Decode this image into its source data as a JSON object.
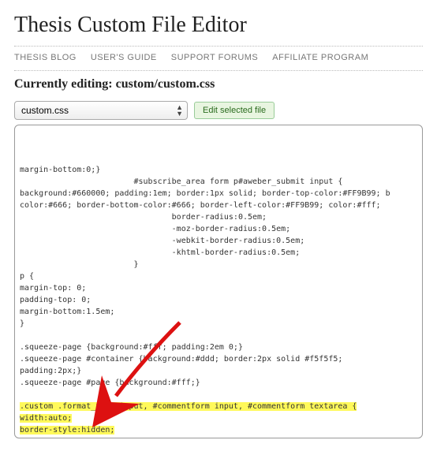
{
  "page": {
    "title": "Thesis Custom File Editor"
  },
  "nav": {
    "items": [
      "THESIS BLOG",
      "USER'S GUIDE",
      "SUPPORT FORUMS",
      "AFFILIATE PROGRAM"
    ]
  },
  "editing": {
    "label": "Currently editing:",
    "filename": "custom/custom.css"
  },
  "controls": {
    "file_select_value": "custom.css",
    "edit_button_label": "Edit selected file"
  },
  "code": {
    "lines": [
      "margin-bottom:0;}",
      "                        #subscribe_area form p#aweber_submit input {",
      "background:#660000; padding:1em; border:1px solid; border-top-color:#FF9B99; b",
      "color:#666; border-bottom-color:#666; border-left-color:#FF9B99; color:#fff;",
      "                                border-radius:0.5em;",
      "                                -moz-border-radius:0.5em;",
      "                                -webkit-border-radius:0.5em;",
      "                                -khtml-border-radius:0.5em;",
      "                        }",
      "p {",
      "margin-top: 0;",
      "padding-top: 0;",
      "margin-bottom:1.5em;",
      "}",
      "",
      ".squeeze-page {background:#fff; padding:2em 0;}",
      ".squeeze-page #container {background:#ddd; border:2px solid #f5f5f5;",
      "padding:2px;}",
      ".squeeze-page #page {background:#fff;}",
      ""
    ],
    "highlighted": [
      ".custom .format_text input, #commentform input, #commentform textarea {",
      "width:auto;",
      "border-style:hidden;",
      "}"
    ]
  }
}
